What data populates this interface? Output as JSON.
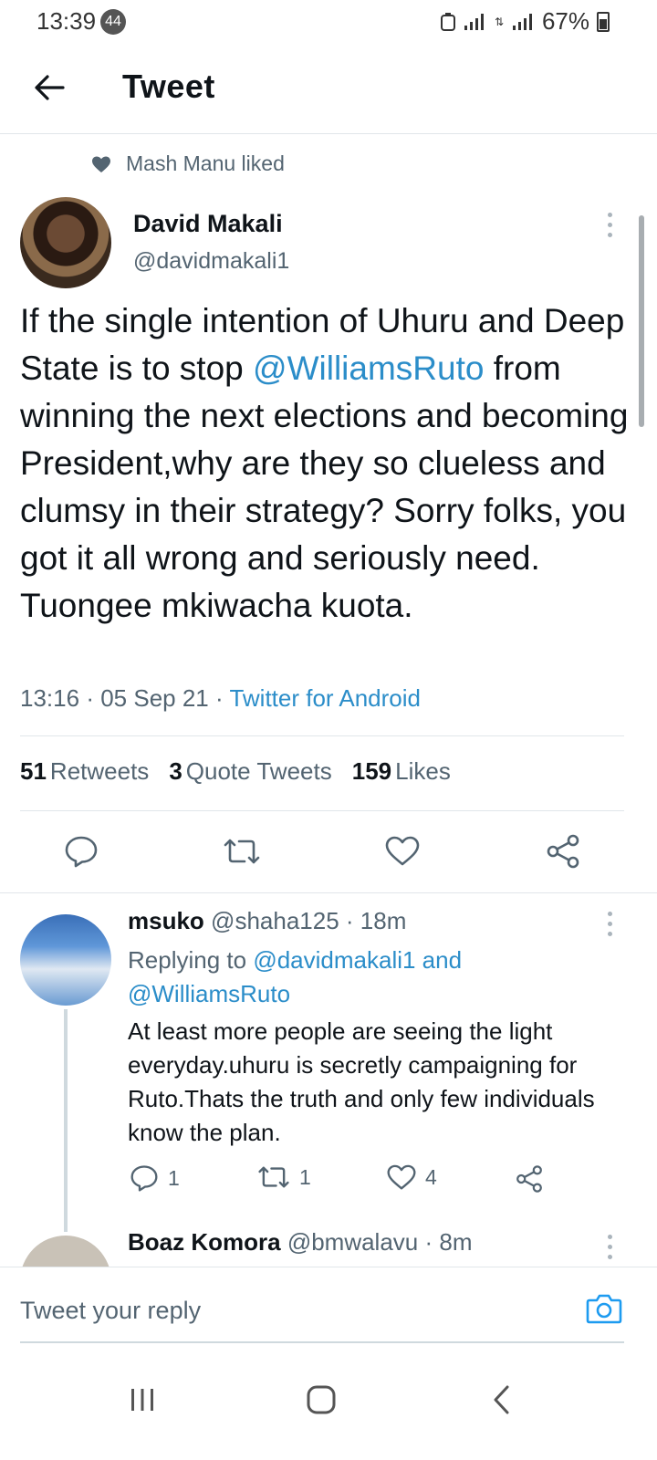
{
  "status_bar": {
    "time": "13:39",
    "notification_count": "44",
    "battery": "67%"
  },
  "header": {
    "title": "Tweet"
  },
  "social_context": {
    "text": "Mash Manu liked"
  },
  "tweet": {
    "author_name": "David Makali",
    "author_handle": "@davidmakali1",
    "text_before": "If the single intention of Uhuru and Deep State is to stop ",
    "mention": "@WilliamsRuto",
    "text_after": " from winning the next elections and becoming President,why are they so clueless and clumsy in their strategy? Sorry folks, you got it all wrong and seriously need. Tuongee mkiwacha kuota.",
    "time": "13:16",
    "date": "05 Sep 21",
    "separator": "·",
    "source": "Twitter for Android"
  },
  "stats": {
    "retweets_count": "51",
    "retweets_label": "Retweets",
    "quotes_count": "3",
    "quotes_label": "Quote Tweets",
    "likes_count": "159",
    "likes_label": "Likes"
  },
  "replies": [
    {
      "name": "msuko",
      "handle": "@shaha125",
      "time": "18m",
      "replying_prefix": "Replying to ",
      "replying_user1": "@davidmakali1",
      "replying_and": " and",
      "replying_user2": "@WilliamsRuto",
      "text": "At least more people are seeing the light everyday.uhuru is secretly campaigning for Ruto.Thats the truth and only few individuals know the plan.",
      "reply_count": "1",
      "retweet_count": "1",
      "like_count": "4"
    },
    {
      "name": "Boaz Komora",
      "handle": "@bmwalavu",
      "time": "8m"
    }
  ],
  "composer": {
    "placeholder": "Tweet your reply"
  },
  "colors": {
    "accent": "#1d9bf0",
    "text": "#0f1419",
    "muted": "#536471"
  }
}
